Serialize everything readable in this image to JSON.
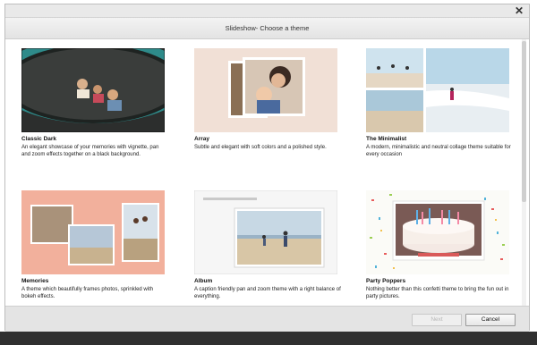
{
  "dialog": {
    "title": "Slideshow- Choose a theme",
    "close_icon": "close-icon"
  },
  "themes": [
    {
      "name": "Classic Dark",
      "description": "An elegant showcase of your memories with vignette, pan and zoom effects together on a black background."
    },
    {
      "name": "Array",
      "description": "Subtle and elegant with soft colors and a polished style."
    },
    {
      "name": "The Minimalist",
      "description": "A modern, minimalistic and neutral collage theme suitable for every occasion"
    },
    {
      "name": "Memories",
      "description": "A theme which beautifully frames photos, sprinkled with bokeh effects."
    },
    {
      "name": "Album",
      "description": "A caption friendly pan and zoom theme with a right balance of everything."
    },
    {
      "name": "Party Poppers",
      "description": "Nothing better than this confetti theme to bring the fun out in party pictures."
    }
  ],
  "footer": {
    "next_label": "Next",
    "cancel_label": "Cancel"
  }
}
